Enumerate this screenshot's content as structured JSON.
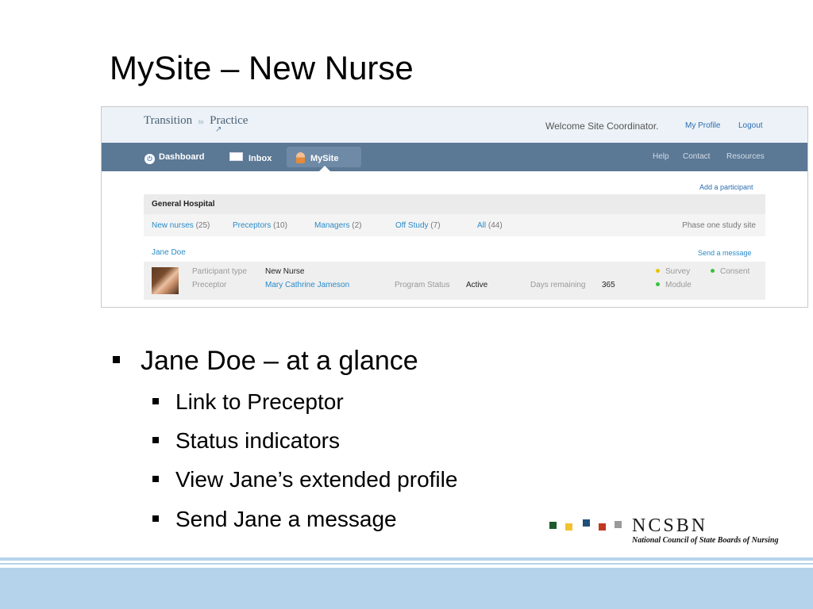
{
  "slide": {
    "title": "MySite – New Nurse",
    "bullets": [
      "Jane Doe – at a glance",
      "Link to Preceptor",
      "Status indicators",
      "View Jane’s extended profile",
      "Send Jane a message"
    ]
  },
  "app": {
    "logo_left": "Transition",
    "logo_mid": "to",
    "logo_right": "Practice",
    "welcome": "Welcome Site Coordinator.",
    "my_profile": "My Profile",
    "logout": "Logout",
    "nav": [
      "Dashboard",
      "Inbox",
      "MySite"
    ],
    "active_nav": "MySite",
    "nav_right": [
      "Help",
      "Contact",
      "Resources"
    ],
    "add_participant": "Add a participant",
    "hospital": "General Hospital",
    "filters": [
      {
        "label": "New nurses",
        "count": "(25)"
      },
      {
        "label": "Preceptors",
        "count": "(10)"
      },
      {
        "label": "Managers",
        "count": "(2)"
      },
      {
        "label": "Off Study",
        "count": "(7)"
      },
      {
        "label": "All",
        "count": "(44)"
      }
    ],
    "phase": "Phase one study site",
    "participant": {
      "name": "Jane Doe",
      "send_message": "Send a message",
      "type_label": "Participant type",
      "type_value": "New Nurse",
      "preceptor_label": "Preceptor",
      "preceptor_value": "Mary Cathrine Jameson",
      "status_label": "Program Status",
      "status_value": "Active",
      "days_label": "Days remaining",
      "days_value": "365",
      "indicators": [
        {
          "label": "Survey",
          "color": "#e8c200"
        },
        {
          "label": "Consent",
          "color": "#36c23a"
        },
        {
          "label": "Module",
          "color": "#36c23a"
        }
      ]
    }
  },
  "branding": {
    "name": "NCSBN",
    "full": "National Council of State Boards of Nursing",
    "square_colors": [
      "#1e5a2e",
      "#f2c230",
      "#1f4f7a",
      "#c2371f",
      "#9a9a9a"
    ]
  }
}
